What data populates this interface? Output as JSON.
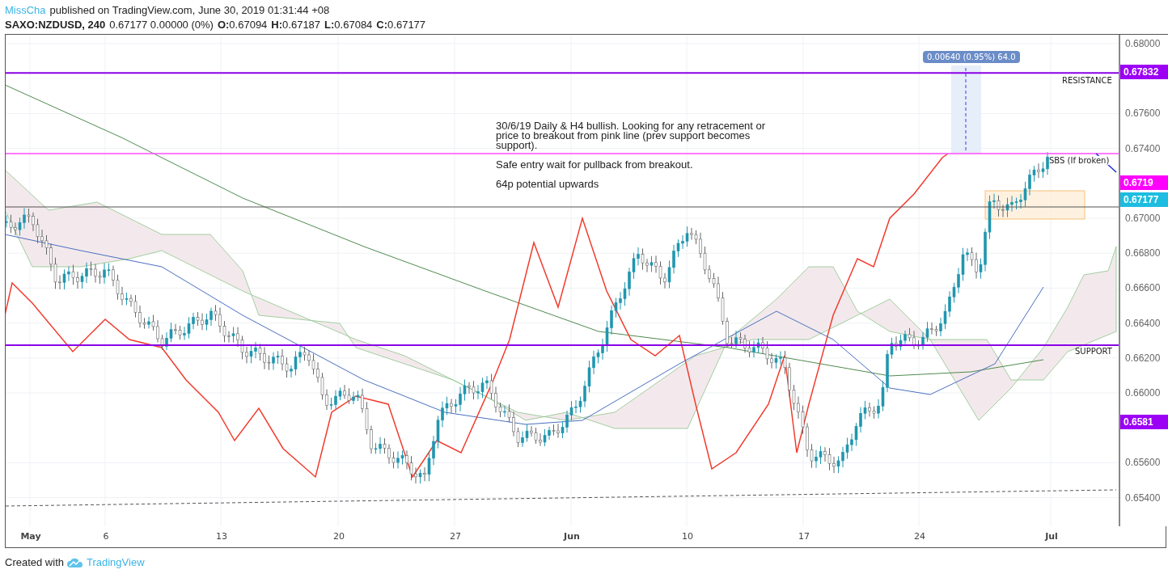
{
  "header": {
    "author": "MissCha",
    "published": "published on TradingView.com, June 30, 2019 01:31:44 +08"
  },
  "legend": {
    "symbol": "SAXO:NZDUSD, 240",
    "last": "0.67177 0.00000 (0%)",
    "ohlc": [
      {
        "label": "O:",
        "value": "0.67094"
      },
      {
        "label": "H:",
        "value": "0.67187"
      },
      {
        "label": "L:",
        "value": "0.67084"
      },
      {
        "label": "C:",
        "value": "0.67177"
      }
    ]
  },
  "chart": {
    "note": "30/6/19 Daily & H4 bullish. Looking for any retracement or price to breakout from pink line (prev support becomes support).",
    "note_2": "Safe entry wait for pullback from breakout.",
    "note_3": "64p potential upwards",
    "measure": "0.00640 (0.95%) 64.0",
    "labels": [
      {
        "kind": "resistance",
        "text": "RESISTANCE"
      },
      {
        "kind": "sbs",
        "text": "SBS (If broken)"
      },
      {
        "kind": "support",
        "text": "SUPPORT"
      }
    ]
  },
  "price_axis": {
    "ticks": [
      "0.68000",
      "0.67600",
      "0.67400",
      "0.67000",
      "0.66800",
      "0.66600",
      "0.66400",
      "0.66200",
      "0.66000",
      "0.65600",
      "0.65400"
    ],
    "tags": [
      {
        "text": "0.67832",
        "color": "#9c00f5"
      },
      {
        "text": "0.6719",
        "color": "#ff00ff"
      },
      {
        "text": "0.67177",
        "color": "#1cbde0"
      },
      {
        "text": "0.6581",
        "color": "#9c00f5"
      }
    ]
  },
  "time_axis": {
    "labels": [
      {
        "text": "May",
        "bold": true
      },
      {
        "text": "6",
        "bold": false
      },
      {
        "text": "13",
        "bold": false
      },
      {
        "text": "20",
        "bold": false
      },
      {
        "text": "27",
        "bold": false
      },
      {
        "text": "Jun",
        "bold": true
      },
      {
        "text": "10",
        "bold": false
      },
      {
        "text": "17",
        "bold": false
      },
      {
        "text": "24",
        "bold": false
      },
      {
        "text": "Jul",
        "bold": true
      }
    ]
  },
  "footer": {
    "text": "Created with",
    "brand": "TradingView"
  }
}
